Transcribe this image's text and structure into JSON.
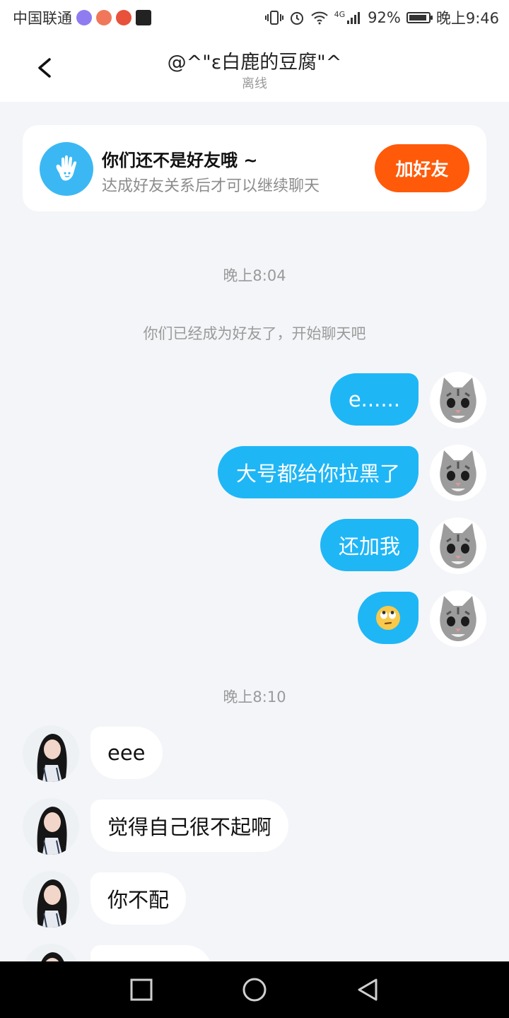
{
  "status_bar": {
    "carrier": "中国联通",
    "network": "4G",
    "battery": "92%",
    "time": "晚上9:46"
  },
  "header": {
    "title": "@^\"ε白鹿的豆腐\"^",
    "subtitle": "离线"
  },
  "friend_card": {
    "title": "你们还不是好友哦 ~",
    "subtitle": "达成好友关系后才可以继续聊天",
    "button_label": "加好友"
  },
  "conversation": {
    "time_1": "晚上8:04",
    "system_message": "你们已经成为好友了，开始聊天吧",
    "outgoing": [
      "e......",
      "大号都给你拉黑了",
      "还加我",
      "🙄"
    ],
    "time_2": "晚上8:10",
    "incoming": [
      "eee",
      "觉得自己很不起啊",
      "你不配"
    ]
  },
  "colors": {
    "accent_blue": "#1fb6f6",
    "add_friend_orange": "#ff5a0a",
    "background": "#f3f5f8"
  },
  "icons": {
    "back": "chevron-left-icon",
    "hand": "wave-hand-icon",
    "nav": [
      "square-recent-icon",
      "circle-home-icon",
      "triangle-back-icon"
    ]
  }
}
